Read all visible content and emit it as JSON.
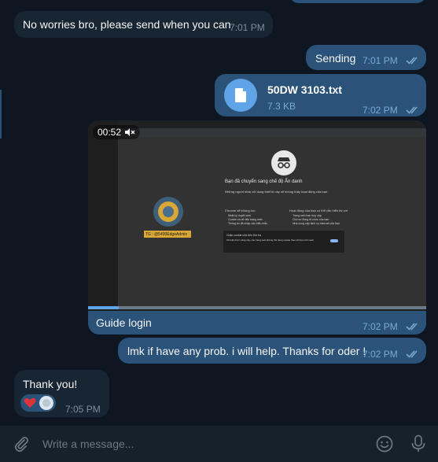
{
  "messages": {
    "m1": {
      "text": "No worries bro, please send when you can",
      "time": "7:01 PM"
    },
    "m2": {
      "text": "Sending",
      "time": "7:01 PM"
    },
    "m3": {
      "file_name": "50DW 3103.txt",
      "file_size": "7.3 KB",
      "time": "7:02 PM"
    },
    "m4": {
      "duration": "00:52",
      "progress": 0.09,
      "caption": "Guide login",
      "time": "7:02 PM",
      "screen": {
        "title": "Bạn đã chuyển sang chế độ Ẩn danh",
        "para": "Những người khác sử dụng thiết bị này sẽ không thấy hoạt động của bạn.",
        "col1_title": "Chrome sẽ không lưu",
        "col1_items": [
          "Nhật ký duyệt web",
          "Cookie và dữ liệu trang web",
          "Thông tin đã nhập vào biểu mẫu"
        ],
        "col2_title": "Hoạt động của bạn có thể vẫn hiển thị với",
        "col2_items": [
          "Trang web bạn truy cập",
          "Chủ sơ đồng tổ chức của bạn",
          "Nhà cung cấp dịch vụ Internet của bạn"
        ],
        "cookie_title": "Chặn cookie của bên thứ ba",
        "cookie_text": "Khi bật chức năng này, các trang web không thể dùng cookie theo dõi bạn trên web.",
        "watermark": "TG : @5400EdgeAdmin"
      }
    },
    "m5": {
      "text": "lmk if have any prob. i will help. Thanks for oder !",
      "time": "7:02 PM"
    },
    "m6": {
      "text": "Thank you!",
      "time": "7:05 PM"
    }
  },
  "composer": {
    "placeholder": "Write a message..."
  },
  "colors": {
    "background": "#0e1621",
    "incoming": "#182533",
    "outgoing": "#2b5278",
    "accent": "#5ea4e6"
  }
}
